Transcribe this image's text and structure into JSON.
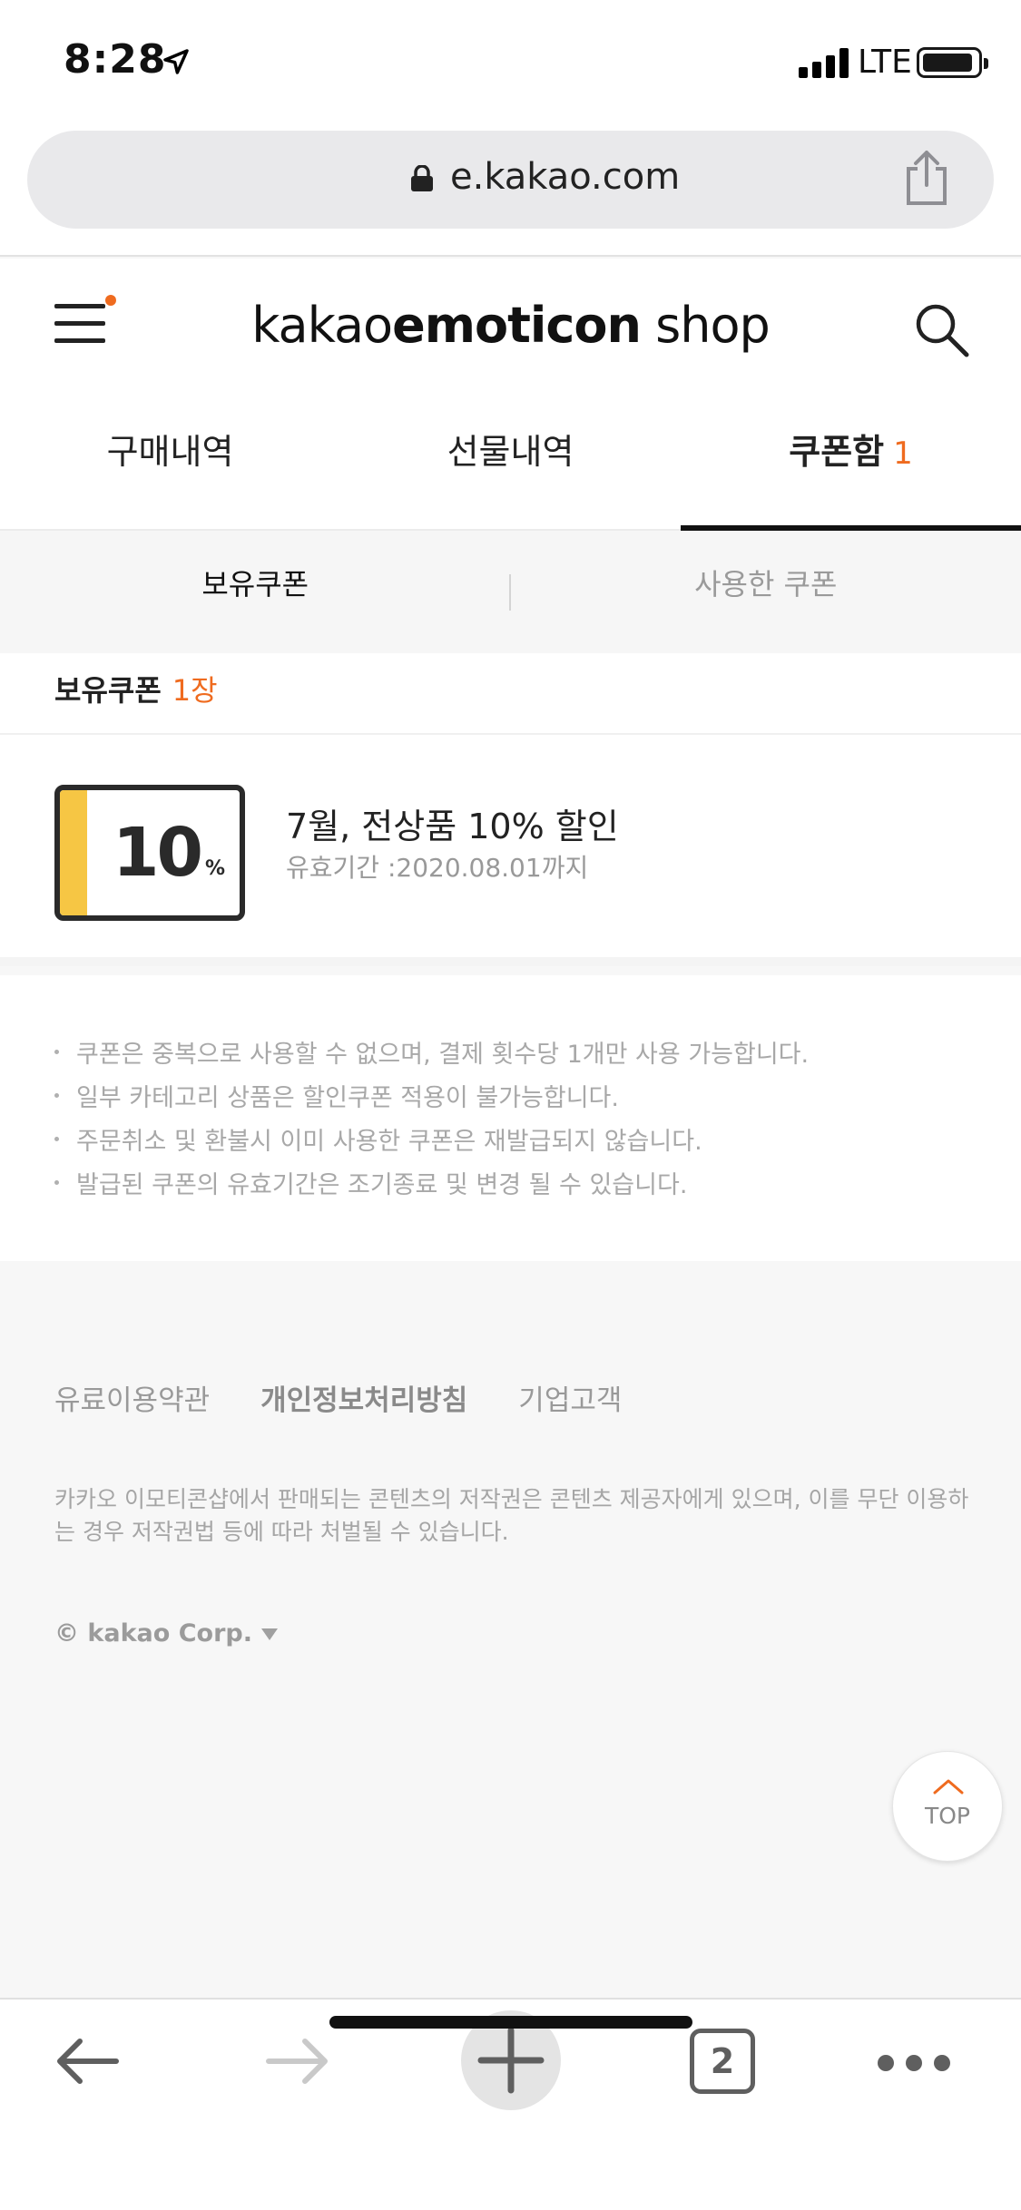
{
  "status_bar": {
    "time": "8:28",
    "network": "LTE",
    "icons": [
      "location-arrow-icon",
      "signal-icon",
      "battery-icon"
    ]
  },
  "browser": {
    "url": "e.kakao.com",
    "tab_count": "2",
    "icons": [
      "lock-icon",
      "share-icon",
      "back-icon",
      "forward-icon",
      "plus-icon",
      "more-icon"
    ]
  },
  "header": {
    "logo_part1": "kakao",
    "logo_part2": "emoticon",
    "logo_part3": " shop",
    "icons": [
      "menu-icon",
      "search-icon"
    ],
    "accent_color": "#ef6b1f"
  },
  "main_tabs": [
    {
      "label": "구매내역"
    },
    {
      "label": "선물내역"
    },
    {
      "label": "쿠폰함",
      "count": "1",
      "active": true
    }
  ],
  "sub_tabs": [
    {
      "label": "보유쿠폰",
      "active": true
    },
    {
      "label": "사용한 쿠폰"
    }
  ],
  "coupon_summary": {
    "label": "보유쿠폰",
    "count": "1장"
  },
  "coupons": [
    {
      "badge_value": "10",
      "badge_unit": "%",
      "title": "7월, 전상품 10% 할인",
      "expiry": "유효기간 :2020.08.01까지",
      "stripe_color": "#f6c644"
    }
  ],
  "notices": [
    "쿠폰은 중복으로 사용할 수 없으며, 결제 횟수당 1개만 사용 가능합니다.",
    "일부 카테고리 상품은 할인쿠폰 적용이 불가능합니다.",
    "주문취소 및 환불시 이미 사용한 쿠폰은 재발급되지 않습니다.",
    "발급된 쿠폰의 유효기간은 조기종료 및 변경 될 수 있습니다."
  ],
  "footer": {
    "links": [
      "유료이용약관",
      "개인정보처리방침",
      "기업고객"
    ],
    "copyright_text": "카카오 이모티콘샵에서 판매되는 콘텐츠의 저작권은 콘텐츠 제공자에게 있으며, 이를 무단 이용하는 경우 저작권법 등에 따라 처벌될 수 있습니다.",
    "corp": "© kakao Corp.",
    "top_label": "TOP"
  }
}
